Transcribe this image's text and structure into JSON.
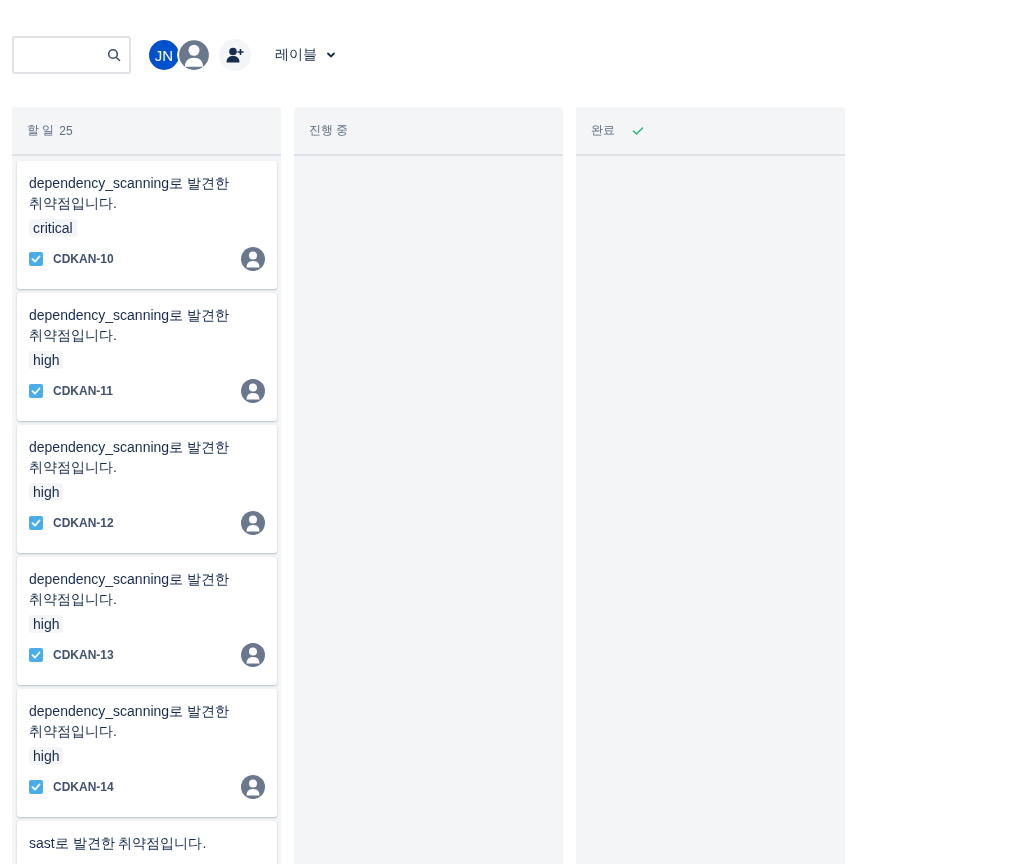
{
  "toolbar": {
    "assignees": [
      {
        "initials": "JN",
        "kind": "initials"
      },
      {
        "kind": "avatar"
      }
    ],
    "label_filter": "레이블"
  },
  "columns": [
    {
      "title": "할 일",
      "count": "25",
      "kind": "todo",
      "cards": [
        {
          "title": "dependency_scanning로 발견한 취약점입니다.",
          "tag": "critical",
          "key": "CDKAN-10"
        },
        {
          "title": "dependency_scanning로 발견한 취약점입니다.",
          "tag": "high",
          "key": "CDKAN-11"
        },
        {
          "title": "dependency_scanning로 발견한 취약점입니다.",
          "tag": "high",
          "key": "CDKAN-12"
        },
        {
          "title": "dependency_scanning로 발견한 취약점입니다.",
          "tag": "high",
          "key": "CDKAN-13"
        },
        {
          "title": "dependency_scanning로 발견한 취약점입니다.",
          "tag": "high",
          "key": "CDKAN-14"
        },
        {
          "title": "sast로 발견한 취약점입니다."
        }
      ]
    },
    {
      "title": "진행 중",
      "kind": "progress"
    },
    {
      "title": "완료",
      "kind": "done"
    }
  ]
}
